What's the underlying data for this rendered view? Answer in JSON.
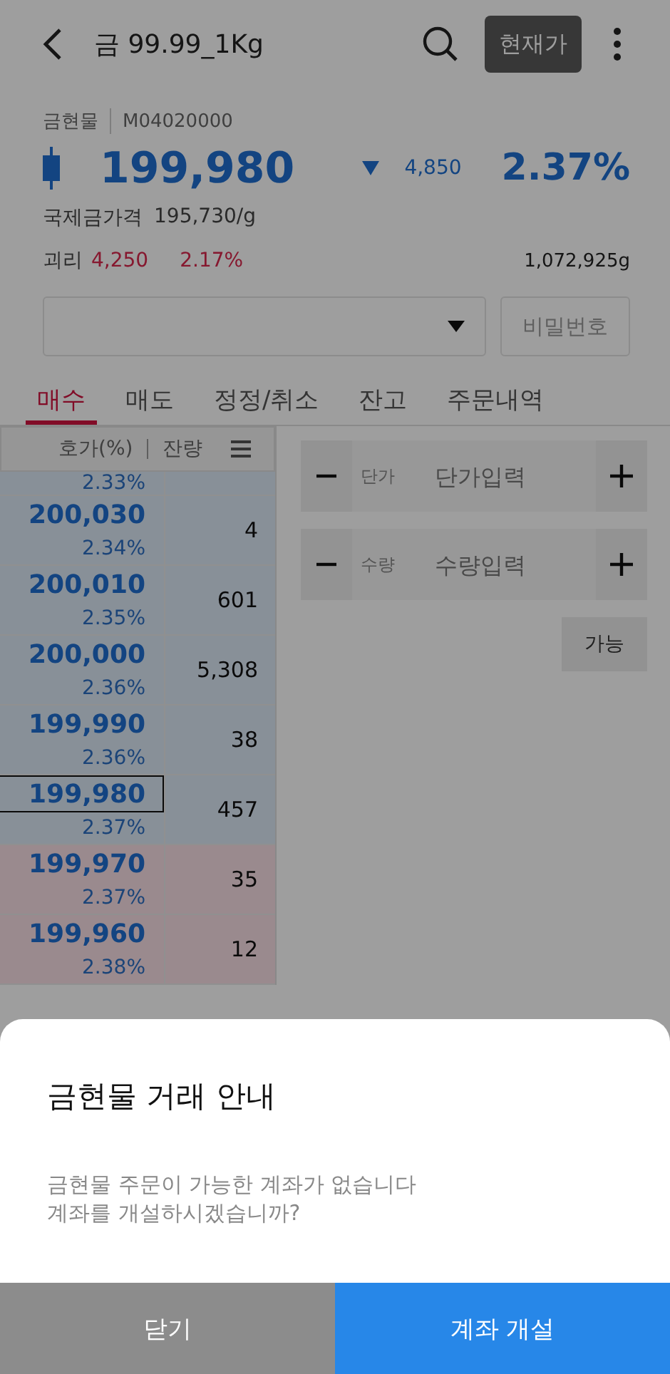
{
  "header": {
    "title": "금 99.99_1Kg",
    "quote_button": "현재가"
  },
  "info": {
    "category": "금현물",
    "code": "M04020000",
    "price": "199,980",
    "change": "4,850",
    "change_rate": "2.37%",
    "intl_label": "국제금가격",
    "intl_price": "195,730/g",
    "gap_label": "괴리",
    "gap_value": "4,250",
    "gap_rate": "2.17%",
    "volume": "1,072,925g"
  },
  "account": {
    "password_button": "비밀번호"
  },
  "tabs": [
    {
      "label": "매수",
      "selected": true
    },
    {
      "label": "매도",
      "selected": false
    },
    {
      "label": "정정/취소",
      "selected": false
    },
    {
      "label": "잔고",
      "selected": false
    },
    {
      "label": "주문내역",
      "selected": false
    }
  ],
  "orderbook": {
    "columns": [
      "호가(%)",
      "잔량"
    ],
    "top_rate": "2.33%",
    "rows": [
      {
        "price": "200,030",
        "rate": "2.34%",
        "qty": "4",
        "kind": "ask",
        "selected": false
      },
      {
        "price": "200,010",
        "rate": "2.35%",
        "qty": "601",
        "kind": "ask",
        "selected": false
      },
      {
        "price": "200,000",
        "rate": "2.36%",
        "qty": "5,308",
        "kind": "ask",
        "selected": false
      },
      {
        "price": "199,990",
        "rate": "2.36%",
        "qty": "38",
        "kind": "ask",
        "selected": false
      },
      {
        "price": "199,980",
        "rate": "2.37%",
        "qty": "457",
        "kind": "ask",
        "selected": true
      },
      {
        "price": "199,970",
        "rate": "2.37%",
        "qty": "35",
        "kind": "bid",
        "selected": false
      },
      {
        "price": "199,960",
        "rate": "2.38%",
        "qty": "12",
        "kind": "bid",
        "selected": false
      }
    ]
  },
  "order_form": {
    "fields": [
      {
        "label": "단가",
        "placeholder": "단가입력"
      },
      {
        "label": "수량",
        "placeholder": "수량입력"
      }
    ],
    "available_button": "가능"
  },
  "dialog": {
    "title": "금현물 거래 안내",
    "message": [
      "금현물 주문이 가능한 계좌가 없습니다",
      "계좌를 개설하시겠습니까?"
    ],
    "buttons": [
      {
        "label": "닫기",
        "kind": "secondary"
      },
      {
        "label": "계좌 개설",
        "kind": "primary"
      }
    ]
  }
}
